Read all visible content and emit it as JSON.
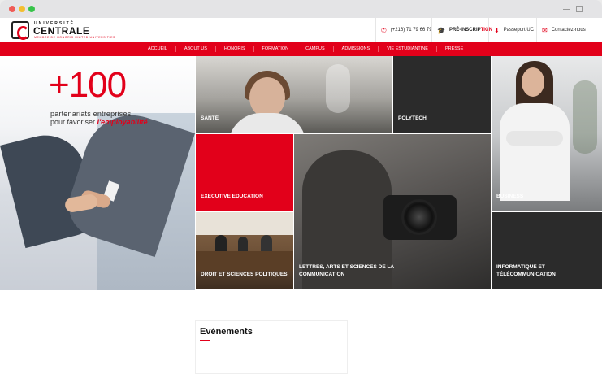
{
  "logo": {
    "top": "UNIVERSITÉ",
    "main": "CENTRALE",
    "sub": "MEMBRE DE HONORIS UNITED UNIVERSITIES"
  },
  "header": {
    "phone": "(+216) 71 79 66 79",
    "preinscription_pre": "PRÉ-INSCRIP",
    "preinscription_accent": "TION",
    "passport": "Passeport UC",
    "contact": "Contactez-nous"
  },
  "nav": {
    "items": [
      "ACCUEIL",
      "ABOUT US",
      "HONORIS",
      "FORMATION",
      "CAMPUS",
      "ADMISSIONS",
      "VIE ESTUDIANTINE",
      "PRESSE"
    ]
  },
  "hero": {
    "number": "+100",
    "line1": "partenariats entreprises",
    "line2_prefix": "pour favoriser ",
    "line2_highlight": "l'employabilité"
  },
  "tiles": {
    "sante": "SANTÉ",
    "polytech": "POLYTECH",
    "business": "BUSINESS",
    "executive": "EXECUTIVE EDUCATION",
    "lettres_1": "LETTRES, ARTS ET SCIENCES DE LA",
    "lettres_2": "COMMUNICATION",
    "droit": "DROIT ET SCIENCES POLITIQUES",
    "info_1": "INFORMATIQUE ET",
    "info_2": "TÉLÉCOMMUNICATION"
  },
  "events": {
    "title": "Evènements"
  },
  "colors": {
    "brand_red": "#e2001a",
    "dark_tile": "#2b2b2b"
  }
}
